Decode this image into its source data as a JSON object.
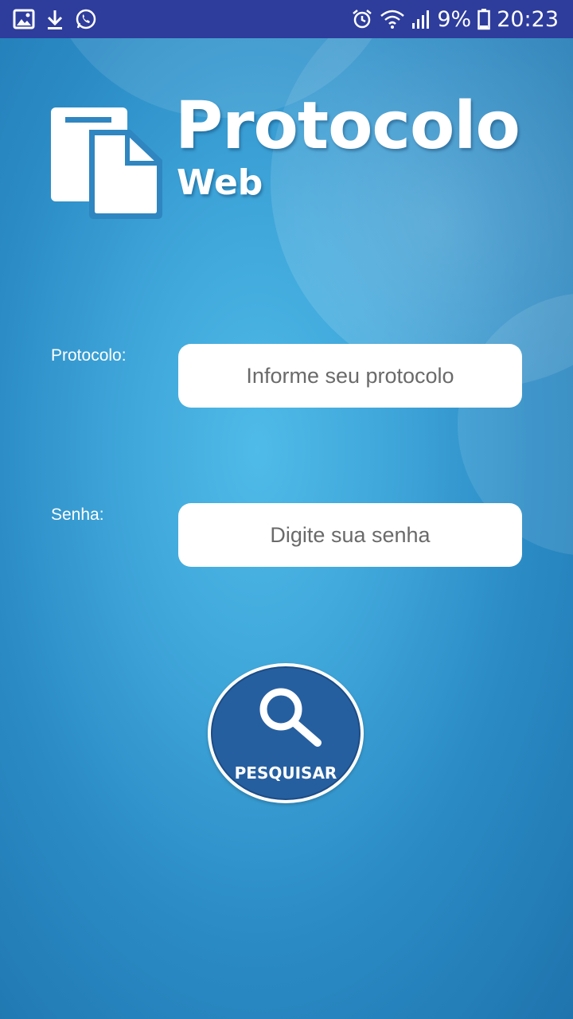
{
  "status_bar": {
    "left_icons": [
      "gallery-icon",
      "download-icon",
      "whatsapp-icon"
    ],
    "right_icons": [
      "alarm-icon",
      "wifi-icon",
      "signal-icon",
      "battery-icon"
    ],
    "battery": "9%",
    "time": "20:23"
  },
  "logo": {
    "title": "Protocolo",
    "subtitle": "Web",
    "icon": "document-icon"
  },
  "form": {
    "protocolo_label": "Protocolo:",
    "protocolo_placeholder": "Informe seu protocolo",
    "senha_label": "Senha:",
    "senha_placeholder": "Digite sua senha"
  },
  "search_button": {
    "label": "PESQUISAR",
    "icon": "magnifier-icon"
  },
  "colors": {
    "status_bar": "#2e3d9c",
    "background": "#3fa6da",
    "button": "#265fa0"
  }
}
